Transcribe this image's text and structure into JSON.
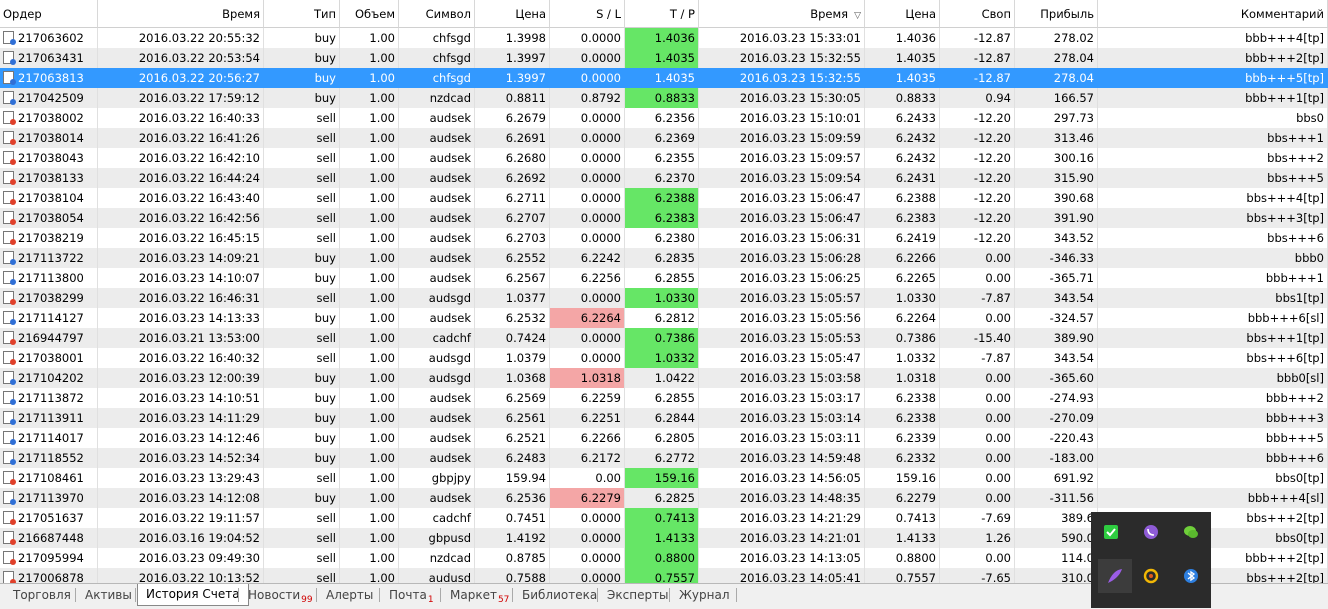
{
  "columns": [
    "Ордер",
    "Время",
    "Тип",
    "Объем",
    "Символ",
    "Цена",
    "S / L",
    "T / P",
    "Время",
    "Цена",
    "Своп",
    "Прибыль",
    "Комментарий"
  ],
  "sort_indicator": "▽",
  "rows": [
    {
      "order": "217063602",
      "open_time": "2016.03.22 20:55:32",
      "type": "buy",
      "volume": "1.00",
      "symbol": "chfsgd",
      "open_price": "1.3998",
      "sl": "0.0000",
      "tp": "1.4036",
      "close_time": "2016.03.23 15:33:01",
      "close_price": "1.4036",
      "swap": "-12.87",
      "profit": "278.02",
      "comment": "bbb+++4[tp]",
      "tp_hit": true,
      "sl_hit": false
    },
    {
      "order": "217063431",
      "open_time": "2016.03.22 20:53:54",
      "type": "buy",
      "volume": "1.00",
      "symbol": "chfsgd",
      "open_price": "1.3997",
      "sl": "0.0000",
      "tp": "1.4035",
      "close_time": "2016.03.23 15:32:55",
      "close_price": "1.4035",
      "swap": "-12.87",
      "profit": "278.04",
      "comment": "bbb+++2[tp]",
      "tp_hit": true,
      "sl_hit": false
    },
    {
      "order": "217063813",
      "open_time": "2016.03.22 20:56:27",
      "type": "buy",
      "volume": "1.00",
      "symbol": "chfsgd",
      "open_price": "1.3997",
      "sl": "0.0000",
      "tp": "1.4035",
      "close_time": "2016.03.23 15:32:55",
      "close_price": "1.4035",
      "swap": "-12.87",
      "profit": "278.04",
      "comment": "bbb+++5[tp]",
      "tp_hit": true,
      "sl_hit": false,
      "selected": true
    },
    {
      "order": "217042509",
      "open_time": "2016.03.22 17:59:12",
      "type": "buy",
      "volume": "1.00",
      "symbol": "nzdcad",
      "open_price": "0.8811",
      "sl": "0.8792",
      "tp": "0.8833",
      "close_time": "2016.03.23 15:30:05",
      "close_price": "0.8833",
      "swap": "0.94",
      "profit": "166.57",
      "comment": "bbb+++1[tp]",
      "tp_hit": true,
      "sl_hit": false
    },
    {
      "order": "217038002",
      "open_time": "2016.03.22 16:40:33",
      "type": "sell",
      "volume": "1.00",
      "symbol": "audsek",
      "open_price": "6.2679",
      "sl": "0.0000",
      "tp": "6.2356",
      "close_time": "2016.03.23 15:10:01",
      "close_price": "6.2433",
      "swap": "-12.20",
      "profit": "297.73",
      "comment": "bbs0",
      "tp_hit": false,
      "sl_hit": false
    },
    {
      "order": "217038014",
      "open_time": "2016.03.22 16:41:26",
      "type": "sell",
      "volume": "1.00",
      "symbol": "audsek",
      "open_price": "6.2691",
      "sl": "0.0000",
      "tp": "6.2369",
      "close_time": "2016.03.23 15:09:59",
      "close_price": "6.2432",
      "swap": "-12.20",
      "profit": "313.46",
      "comment": "bbs+++1",
      "tp_hit": false,
      "sl_hit": false
    },
    {
      "order": "217038043",
      "open_time": "2016.03.22 16:42:10",
      "type": "sell",
      "volume": "1.00",
      "symbol": "audsek",
      "open_price": "6.2680",
      "sl": "0.0000",
      "tp": "6.2355",
      "close_time": "2016.03.23 15:09:57",
      "close_price": "6.2432",
      "swap": "-12.20",
      "profit": "300.16",
      "comment": "bbs+++2",
      "tp_hit": false,
      "sl_hit": false
    },
    {
      "order": "217038133",
      "open_time": "2016.03.22 16:44:24",
      "type": "sell",
      "volume": "1.00",
      "symbol": "audsek",
      "open_price": "6.2692",
      "sl": "0.0000",
      "tp": "6.2370",
      "close_time": "2016.03.23 15:09:54",
      "close_price": "6.2431",
      "swap": "-12.20",
      "profit": "315.90",
      "comment": "bbs+++5",
      "tp_hit": false,
      "sl_hit": false
    },
    {
      "order": "217038104",
      "open_time": "2016.03.22 16:43:40",
      "type": "sell",
      "volume": "1.00",
      "symbol": "audsek",
      "open_price": "6.2711",
      "sl": "0.0000",
      "tp": "6.2388",
      "close_time": "2016.03.23 15:06:47",
      "close_price": "6.2388",
      "swap": "-12.20",
      "profit": "390.68",
      "comment": "bbs+++4[tp]",
      "tp_hit": true,
      "sl_hit": false
    },
    {
      "order": "217038054",
      "open_time": "2016.03.22 16:42:56",
      "type": "sell",
      "volume": "1.00",
      "symbol": "audsek",
      "open_price": "6.2707",
      "sl": "0.0000",
      "tp": "6.2383",
      "close_time": "2016.03.23 15:06:47",
      "close_price": "6.2383",
      "swap": "-12.20",
      "profit": "391.90",
      "comment": "bbs+++3[tp]",
      "tp_hit": true,
      "sl_hit": false
    },
    {
      "order": "217038219",
      "open_time": "2016.03.22 16:45:15",
      "type": "sell",
      "volume": "1.00",
      "symbol": "audsek",
      "open_price": "6.2703",
      "sl": "0.0000",
      "tp": "6.2380",
      "close_time": "2016.03.23 15:06:31",
      "close_price": "6.2419",
      "swap": "-12.20",
      "profit": "343.52",
      "comment": "bbs+++6",
      "tp_hit": false,
      "sl_hit": false
    },
    {
      "order": "217113722",
      "open_time": "2016.03.23 14:09:21",
      "type": "buy",
      "volume": "1.00",
      "symbol": "audsek",
      "open_price": "6.2552",
      "sl": "6.2242",
      "tp": "6.2835",
      "close_time": "2016.03.23 15:06:28",
      "close_price": "6.2266",
      "swap": "0.00",
      "profit": "-346.33",
      "comment": "bbb0",
      "tp_hit": false,
      "sl_hit": false
    },
    {
      "order": "217113800",
      "open_time": "2016.03.23 14:10:07",
      "type": "buy",
      "volume": "1.00",
      "symbol": "audsek",
      "open_price": "6.2567",
      "sl": "6.2256",
      "tp": "6.2855",
      "close_time": "2016.03.23 15:06:25",
      "close_price": "6.2265",
      "swap": "0.00",
      "profit": "-365.71",
      "comment": "bbb+++1",
      "tp_hit": false,
      "sl_hit": false
    },
    {
      "order": "217038299",
      "open_time": "2016.03.22 16:46:31",
      "type": "sell",
      "volume": "1.00",
      "symbol": "audsgd",
      "open_price": "1.0377",
      "sl": "0.0000",
      "tp": "1.0330",
      "close_time": "2016.03.23 15:05:57",
      "close_price": "1.0330",
      "swap": "-7.87",
      "profit": "343.54",
      "comment": "bbs1[tp]",
      "tp_hit": true,
      "sl_hit": false
    },
    {
      "order": "217114127",
      "open_time": "2016.03.23 14:13:33",
      "type": "buy",
      "volume": "1.00",
      "symbol": "audsek",
      "open_price": "6.2532",
      "sl": "6.2264",
      "tp": "6.2812",
      "close_time": "2016.03.23 15:05:56",
      "close_price": "6.2264",
      "swap": "0.00",
      "profit": "-324.57",
      "comment": "bbb+++6[sl]",
      "tp_hit": false,
      "sl_hit": true
    },
    {
      "order": "216944797",
      "open_time": "2016.03.21 13:53:00",
      "type": "sell",
      "volume": "1.00",
      "symbol": "cadchf",
      "open_price": "0.7424",
      "sl": "0.0000",
      "tp": "0.7386",
      "close_time": "2016.03.23 15:05:53",
      "close_price": "0.7386",
      "swap": "-15.40",
      "profit": "389.90",
      "comment": "bbs+++1[tp]",
      "tp_hit": true,
      "sl_hit": false
    },
    {
      "order": "217038001",
      "open_time": "2016.03.22 16:40:32",
      "type": "sell",
      "volume": "1.00",
      "symbol": "audsgd",
      "open_price": "1.0379",
      "sl": "0.0000",
      "tp": "1.0332",
      "close_time": "2016.03.23 15:05:47",
      "close_price": "1.0332",
      "swap": "-7.87",
      "profit": "343.54",
      "comment": "bbs+++6[tp]",
      "tp_hit": true,
      "sl_hit": false
    },
    {
      "order": "217104202",
      "open_time": "2016.03.23 12:00:39",
      "type": "buy",
      "volume": "1.00",
      "symbol": "audsgd",
      "open_price": "1.0368",
      "sl": "1.0318",
      "tp": "1.0422",
      "close_time": "2016.03.23 15:03:58",
      "close_price": "1.0318",
      "swap": "0.00",
      "profit": "-365.60",
      "comment": "bbb0[sl]",
      "tp_hit": false,
      "sl_hit": true
    },
    {
      "order": "217113872",
      "open_time": "2016.03.23 14:10:51",
      "type": "buy",
      "volume": "1.00",
      "symbol": "audsek",
      "open_price": "6.2569",
      "sl": "6.2259",
      "tp": "6.2855",
      "close_time": "2016.03.23 15:03:17",
      "close_price": "6.2338",
      "swap": "0.00",
      "profit": "-274.93",
      "comment": "bbb+++2",
      "tp_hit": false,
      "sl_hit": false
    },
    {
      "order": "217113911",
      "open_time": "2016.03.23 14:11:29",
      "type": "buy",
      "volume": "1.00",
      "symbol": "audsek",
      "open_price": "6.2561",
      "sl": "6.2251",
      "tp": "6.2844",
      "close_time": "2016.03.23 15:03:14",
      "close_price": "6.2338",
      "swap": "0.00",
      "profit": "-270.09",
      "comment": "bbb+++3",
      "tp_hit": false,
      "sl_hit": false
    },
    {
      "order": "217114017",
      "open_time": "2016.03.23 14:12:46",
      "type": "buy",
      "volume": "1.00",
      "symbol": "audsek",
      "open_price": "6.2521",
      "sl": "6.2266",
      "tp": "6.2805",
      "close_time": "2016.03.23 15:03:11",
      "close_price": "6.2339",
      "swap": "0.00",
      "profit": "-220.43",
      "comment": "bbb+++5",
      "tp_hit": false,
      "sl_hit": false
    },
    {
      "order": "217118552",
      "open_time": "2016.03.23 14:52:34",
      "type": "buy",
      "volume": "1.00",
      "symbol": "audsek",
      "open_price": "6.2483",
      "sl": "6.2172",
      "tp": "6.2772",
      "close_time": "2016.03.23 14:59:48",
      "close_price": "6.2332",
      "swap": "0.00",
      "profit": "-183.00",
      "comment": "bbb+++6",
      "tp_hit": false,
      "sl_hit": false
    },
    {
      "order": "217108461",
      "open_time": "2016.03.23 13:29:43",
      "type": "sell",
      "volume": "1.00",
      "symbol": "gbpjpy",
      "open_price": "159.94",
      "sl": "0.00",
      "tp": "159.16",
      "close_time": "2016.03.23 14:56:05",
      "close_price": "159.16",
      "swap": "0.00",
      "profit": "691.92",
      "comment": "bbs0[tp]",
      "tp_hit": true,
      "sl_hit": false
    },
    {
      "order": "217113970",
      "open_time": "2016.03.23 14:12:08",
      "type": "buy",
      "volume": "1.00",
      "symbol": "audsek",
      "open_price": "6.2536",
      "sl": "6.2279",
      "tp": "6.2825",
      "close_time": "2016.03.23 14:48:35",
      "close_price": "6.2279",
      "swap": "0.00",
      "profit": "-311.56",
      "comment": "bbb+++4[sl]",
      "tp_hit": false,
      "sl_hit": true
    },
    {
      "order": "217051637",
      "open_time": "2016.03.22 19:11:57",
      "type": "sell",
      "volume": "1.00",
      "symbol": "cadchf",
      "open_price": "0.7451",
      "sl": "0.0000",
      "tp": "0.7413",
      "close_time": "2016.03.23 14:21:29",
      "close_price": "0.7413",
      "swap": "-7.69",
      "profit": "389.6",
      "comment": "bbs+++2[tp]",
      "tp_hit": true,
      "sl_hit": false
    },
    {
      "order": "216687448",
      "open_time": "2016.03.16 19:04:52",
      "type": "sell",
      "volume": "1.00",
      "symbol": "gbpusd",
      "open_price": "1.4192",
      "sl": "0.0000",
      "tp": "1.4133",
      "close_time": "2016.03.23 14:21:01",
      "close_price": "1.4133",
      "swap": "1.26",
      "profit": "590.0",
      "comment": "bbs0[tp]",
      "tp_hit": true,
      "sl_hit": false
    },
    {
      "order": "217095994",
      "open_time": "2016.03.23 09:49:30",
      "type": "sell",
      "volume": "1.00",
      "symbol": "nzdcad",
      "open_price": "0.8785",
      "sl": "0.0000",
      "tp": "0.8800",
      "close_time": "2016.03.23 14:13:05",
      "close_price": "0.8800",
      "swap": "0.00",
      "profit": "114.0",
      "comment": "bbb+++2[tp]",
      "tp_hit": true,
      "sl_hit": false
    },
    {
      "order": "217006878",
      "open_time": "2016.03.22 10:13:52",
      "type": "sell",
      "volume": "1.00",
      "symbol": "audusd",
      "open_price": "0.7588",
      "sl": "0.0000",
      "tp": "0.7557",
      "close_time": "2016.03.23 14:05:41",
      "close_price": "0.7557",
      "swap": "-7.65",
      "profit": "310.0",
      "comment": "bbs+++2[tp]",
      "tp_hit": true,
      "sl_hit": false
    }
  ],
  "tabs": [
    {
      "label": "Торговля"
    },
    {
      "label": "Активы"
    },
    {
      "label": "История Счета",
      "active": true
    },
    {
      "label": "Новости",
      "badge": "99"
    },
    {
      "label": "Алерты"
    },
    {
      "label": "Почта",
      "badge": "1"
    },
    {
      "label": "Маркет",
      "badge": "57"
    },
    {
      "label": "Библиотека"
    },
    {
      "label": "Эксперты"
    },
    {
      "label": "Журнал"
    }
  ],
  "tray_icons": [
    {
      "icon": "checkmark-icon",
      "color": "#2ecc40"
    },
    {
      "icon": "viber-icon",
      "color": "#8e5bd6"
    },
    {
      "icon": "wechat-icon",
      "color": "#6fcf3a"
    },
    {
      "icon": "feather-icon",
      "color": "#9b5de5"
    },
    {
      "icon": "sync-icon",
      "color": "#f2b705"
    },
    {
      "icon": "bluetooth-icon",
      "color": "#2d7fe0"
    }
  ],
  "colors": {
    "selection": "#3399ff",
    "tp_hit": "#66e666",
    "sl_hit": "#f4a6a6",
    "alt_row": "#ececec"
  }
}
